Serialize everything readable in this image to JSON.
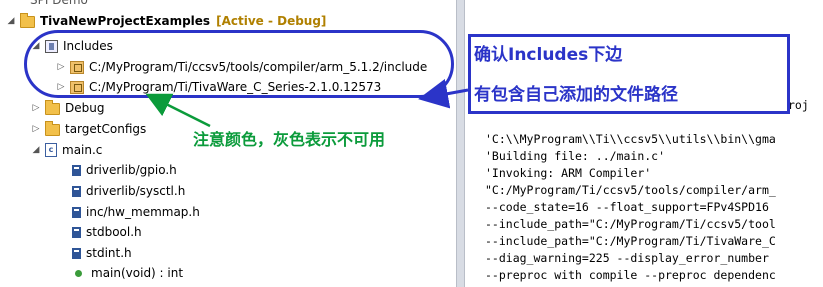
{
  "tree": {
    "partial_top": "SPI Demo",
    "project": {
      "name": "TivaNewProjectExamples",
      "status": "[Active - Debug]"
    },
    "includes": {
      "label": "Includes",
      "paths": [
        "C:/MyProgram/Ti/ccsv5/tools/compiler/arm_5.1.2/include",
        "C:/MyProgram/Ti/TivaWare_C_Series-2.1.0.12573"
      ]
    },
    "folders": [
      "Debug",
      "targetConfigs"
    ],
    "main_file": "main.c",
    "main_children": [
      "driverlib/gpio.h",
      "driverlib/sysctl.h",
      "inc/hw_memmap.h",
      "stdbool.h",
      "stdint.h",
      "main(void) : int"
    ]
  },
  "console": {
    "partial_roj": "roj",
    "lines": [
      "'C:\\\\MyProgram\\\\Ti\\\\ccsv5\\\\utils\\\\bin\\\\gma",
      "'Building file: ../main.c'",
      "'Invoking: ARM Compiler'",
      "\"C:/MyProgram/Ti/ccsv5/tools/compiler/arm_",
      "--code_state=16 --float_support=FPv4SPD16",
      "--include_path=\"C:/MyProgram/Ti/ccsv5/tool",
      "--include_path=\"C:/MyProgram/Ti/TivaWare_C",
      "--diag_warning=225 --display_error_number",
      "--preproc with compile --preproc dependenc"
    ]
  },
  "annotations": {
    "callout_line1": "确认Includes下边",
    "callout_line2": "有包含自己添加的文件路径",
    "green_note": "注意颜色，灰色表示不可用"
  },
  "colors": {
    "annotation_blue": "#2b34c8",
    "annotation_green": "#0b9b3b",
    "active_status": "#b08000"
  }
}
